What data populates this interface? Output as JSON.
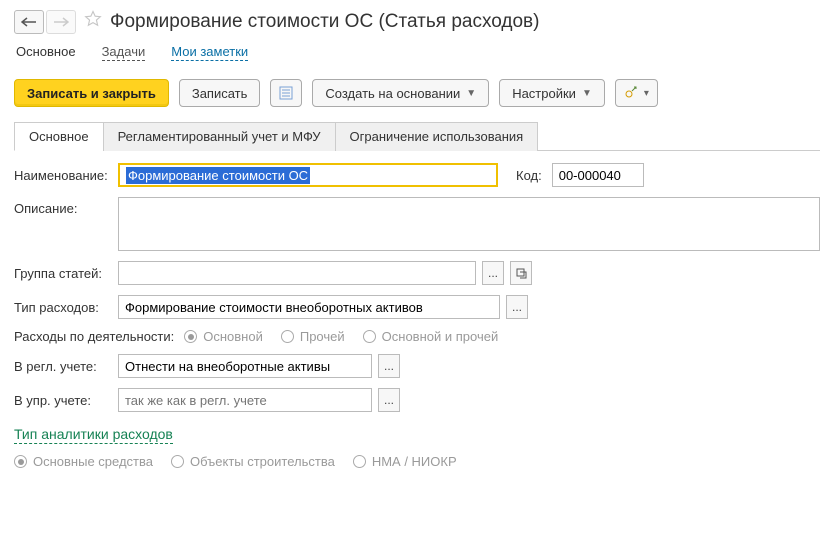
{
  "header": {
    "title": "Формирование стоимости ОС (Статья расходов)"
  },
  "link_row": {
    "main": "Основное",
    "tasks": "Задачи",
    "notes": "Мои заметки"
  },
  "toolbar": {
    "save_close": "Записать и закрыть",
    "save": "Записать",
    "create_based": "Создать на основании",
    "settings": "Настройки"
  },
  "form_tabs": {
    "main": "Основное",
    "reg": "Регламентированный учет и МФУ",
    "restrict": "Ограничение использования"
  },
  "labels": {
    "name": "Наименование:",
    "code": "Код:",
    "description": "Описание:",
    "group": "Группа статей:",
    "expense_type": "Тип расходов:",
    "activity": "Расходы по деятельности:",
    "reg_acc": "В регл. учете:",
    "mgmt_acc": "В упр. учете:",
    "analytics_section": "Тип аналитики расходов"
  },
  "values": {
    "name": "Формирование стоимости ОС",
    "code": "00-000040",
    "description": "",
    "group": "",
    "expense_type": "Формирование стоимости внеоборотных активов",
    "reg_acc": "Отнести на внеоборотные активы",
    "mgmt_acc_placeholder": "так же как в регл. учете"
  },
  "radios": {
    "activity": {
      "main": "Основной",
      "other": "Прочей",
      "both": "Основной и прочей"
    },
    "analytics": {
      "fixed_assets": "Основные средства",
      "construction": "Объекты строительства",
      "nma": "НМА / НИОКР"
    }
  }
}
